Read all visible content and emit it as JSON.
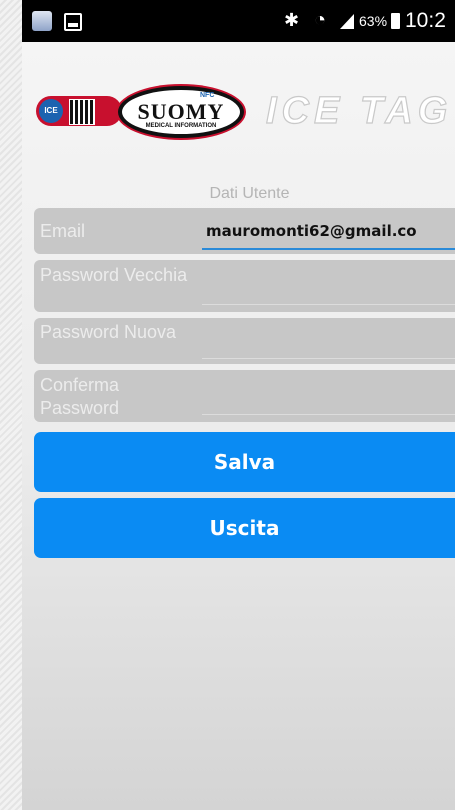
{
  "statusbar": {
    "icons": [
      "app-notification-icon",
      "screenshot-icon",
      "bluetooth-icon",
      "wifi-icon",
      "signal-icon",
      "battery-icon"
    ],
    "battery": "63%",
    "time": "10:2"
  },
  "logo": {
    "ice_badge": "ICE",
    "brand": "SUOMY",
    "brand_sub": "MEDICAL INFORMATION",
    "nfc": "NFC",
    "product": "ICE TAG"
  },
  "form": {
    "section_title": "Dati Utente",
    "email_label": "Email",
    "email_value": "mauromonti62@gmail.co",
    "old_password_label": "Password Vecchia",
    "new_password_label": "Password Nuova",
    "confirm_password_label": "Conferma Password"
  },
  "actions": {
    "save_label": "Salva",
    "exit_label": "Uscita"
  },
  "colors": {
    "button": "#0a8bf3",
    "row_bg": "#c7c7c7",
    "brand_red": "#c8102e"
  }
}
